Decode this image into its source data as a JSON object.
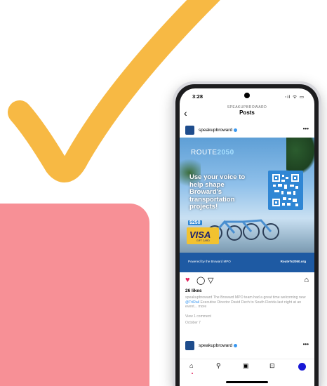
{
  "colors": {
    "check": "#f7b944",
    "pink": "#f79096",
    "brand_blue": "#1e5aa3",
    "like_red": "#e0245e",
    "verified": "#3897f0"
  },
  "status_bar": {
    "time": "3:28",
    "icons": "◦il ᯤ ▭"
  },
  "header": {
    "account": "SPEAKUPBROWARD",
    "title": "Posts",
    "back_icon": "chevron-left-icon"
  },
  "post": {
    "username": "speakupbroward",
    "avatar_text": "Speak Up Broward",
    "more": "•••",
    "image": {
      "route_prefix": "ROUTE",
      "route_num": "2050",
      "headline": "Use your voice to help shape Broward's transportation projects!",
      "promo_amount": "$250",
      "promo_card": "VISA",
      "promo_sub": "GIFT CARD",
      "powered_by": "Powered by the Broward MPO",
      "website": "RouteTo2050.org"
    },
    "likes": "26 likes",
    "caption_user": "speakupbroward",
    "caption_text": "The Broward MPO team had a great time welcoming new",
    "caption_link": "@TriRail",
    "caption_text2": "Executive Director David Dech to South Florida last night at an event...",
    "caption_more": "more",
    "view_comments": "View 1 comment",
    "time_ago": "October 7"
  },
  "post2": {
    "username": "speakupbroward",
    "more": "•••"
  },
  "nav": [
    "home-icon",
    "search-icon",
    "reels-icon",
    "shop-icon",
    "profile-avatar"
  ]
}
